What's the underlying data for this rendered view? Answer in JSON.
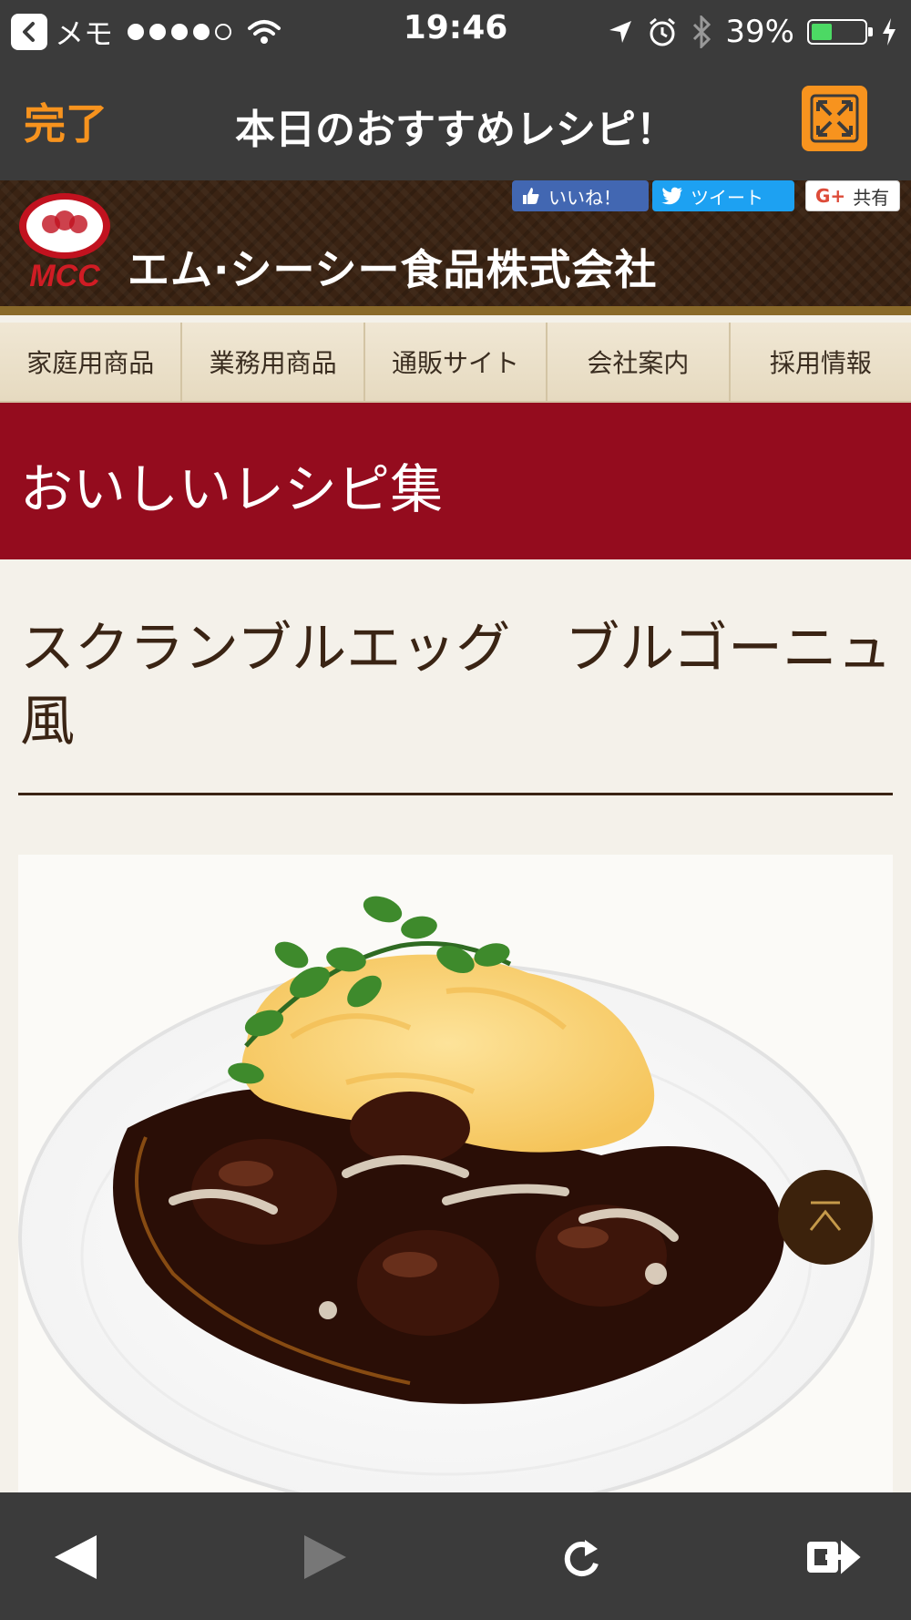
{
  "status_bar": {
    "back_app": "メモ",
    "time": "19:46",
    "battery_percent": "39%",
    "battery_level": 0.39,
    "signal_bars_filled": 4,
    "signal_bars_total": 5
  },
  "nav_header": {
    "done_label": "完了",
    "title": "本日のおすすめレシピ！"
  },
  "site_header": {
    "company_name": "エム·シーシー食品株式会社",
    "logo_text": "MCC",
    "social": {
      "like": "いいね！",
      "tweet": "ツイート",
      "share": "共有"
    }
  },
  "menu": {
    "items": [
      "家庭用商品",
      "業務用商品",
      "通販サイト",
      "会社案内",
      "採用情報"
    ]
  },
  "section": {
    "title": "おいしいレシピ集"
  },
  "recipe": {
    "title": "スクランブルエッグ　ブルゴーニュ風"
  },
  "colors": {
    "accent_orange": "#f7931e",
    "banner_red": "#940c1e",
    "bar_dark": "#3b3b3b",
    "header_brown": "#3a2313"
  }
}
